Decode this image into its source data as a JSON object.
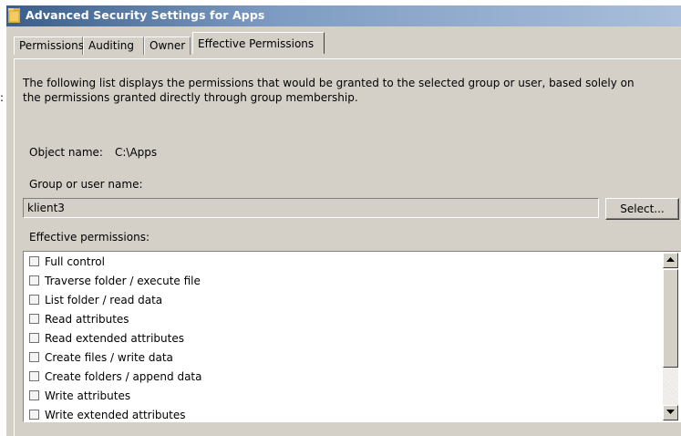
{
  "window": {
    "title": "Advanced Security Settings for Apps",
    "title_bar_color": "#3a5e8a"
  },
  "tabs": [
    {
      "label": "Permissions",
      "active": false
    },
    {
      "label": "Auditing",
      "active": false
    },
    {
      "label": "Owner",
      "active": false
    },
    {
      "label": "Effective Permissions",
      "active": true
    }
  ],
  "description": "The following list displays the permissions that would be granted to the selected group or user, based solely on the permissions granted directly through group membership.",
  "object": {
    "label": "Object name:",
    "value": "C:\\Apps"
  },
  "group_user": {
    "label": "Group or user name:",
    "value": "klient3",
    "select_button": "Select..."
  },
  "effective_permissions": {
    "label": "Effective permissions:",
    "items": [
      {
        "label": "Full control",
        "checked": false
      },
      {
        "label": "Traverse folder / execute file",
        "checked": false
      },
      {
        "label": "List folder / read data",
        "checked": false
      },
      {
        "label": "Read attributes",
        "checked": false
      },
      {
        "label": "Read extended attributes",
        "checked": false
      },
      {
        "label": "Create files / write data",
        "checked": false
      },
      {
        "label": "Create folders / append data",
        "checked": false
      },
      {
        "label": "Write attributes",
        "checked": false
      },
      {
        "label": "Write extended attributes",
        "checked": false
      }
    ]
  },
  "left_edge_mark": ":"
}
